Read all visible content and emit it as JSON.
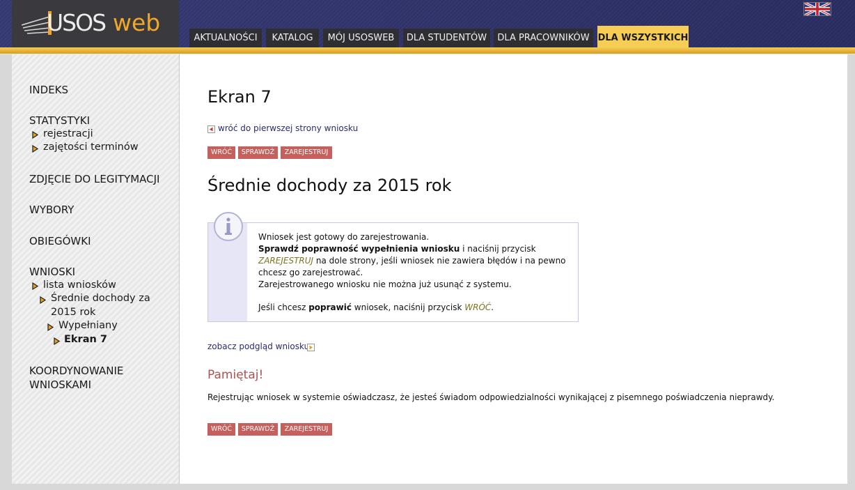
{
  "header": {
    "logo_usos": "USOS",
    "logo_web": "web",
    "tabs": [
      {
        "label": "AKTUALNOŚCI"
      },
      {
        "label": "KATALOG"
      },
      {
        "label": "MÓJ USOSWEB"
      },
      {
        "label": "DLA STUDENTÓW"
      },
      {
        "label": "DLA PRACOWNIKÓW"
      },
      {
        "label": "DLA WSZYSTKICH",
        "active": true
      }
    ],
    "language_flag": "uk-flag-icon"
  },
  "sidebar": {
    "indeks": "INDEKS",
    "statystyki": "STATYSTYKI",
    "rejestracji": "rejestracji",
    "zajetosci": "zajętości terminów",
    "zdjecie": "ZDJĘCIE DO LEGITYMACJI",
    "wybory": "WYBORY",
    "obiegowki": "OBIEGÓWKI",
    "wnioski": "WNIOSKI",
    "lista": "lista wniosków",
    "srednie_line1": "Średnie dochody za",
    "srednie_line2": "2015 rok",
    "wypelniany": "Wypełniany",
    "ekran": "Ekran 7",
    "koord_line1": "KOORDYNOWANIE",
    "koord_line2": "WNIOSKAMI"
  },
  "main": {
    "page_title": "Ekran 7",
    "back_link": "wróć do pierwszej strony wniosku",
    "buttons": {
      "back": "WRÓĆ",
      "check": "SPRAWDŹ",
      "register": "ZAREJESTRUJ"
    },
    "form_title": "Średnie dochody za 2015 rok",
    "info": {
      "line1": "Wniosek jest gotowy do zarejestrowania.",
      "line2_bold": "Sprawdź poprawność wypełnienia wniosku",
      "line2_rest": " i naciśnij przycisk",
      "line3_ital": "ZAREJESTRUJ",
      "line3_rest": " na dole strony, jeśli wniosek nie zawiera błędów i na pewno",
      "line4": "chcesz go zarejestrować.",
      "line5": "Zarejestrowanego wniosku nie można już usunąć z systemu.",
      "line6_a": "Jeśli chcesz ",
      "line6_bold": "poprawić",
      "line6_b": " wniosek, naciśnij przycisk ",
      "line6_ital": "WRÓĆ",
      "line6_end": "."
    },
    "preview_link": "zobacz podgląd wniosku",
    "remember_title": "Pamiętaj!",
    "remember_text": "Rejestrując wniosek w systemie oświadczasz, że jesteś świadom odpowiedzialności wynikającej z pisemnego poświadczenia nieprawdy."
  },
  "colors": {
    "header_bg": "#3b3f78",
    "accent_gold": "#f6cd55",
    "logo_web": "#f1a82a",
    "button_bg": "#c6605c",
    "link": "#2a2a75",
    "remember": "#b2504e",
    "info_strip": "#e6e6f6"
  }
}
